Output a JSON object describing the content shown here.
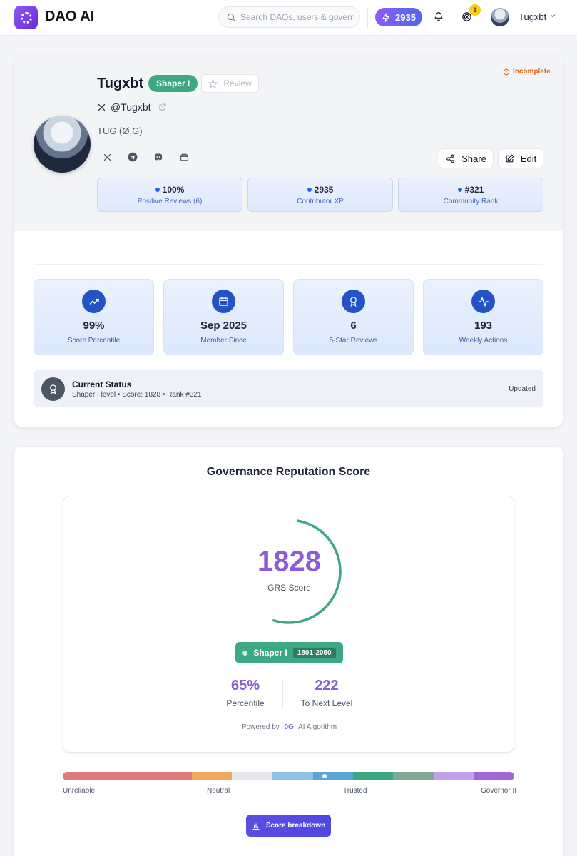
{
  "app": {
    "name": "DAO AI"
  },
  "search": {
    "placeholder": "Search DAOs, users & governance"
  },
  "header": {
    "xp": "2935",
    "notification_count": "1",
    "username": "Tugxbt"
  },
  "profile": {
    "name": "Tugxbt",
    "level": "Shaper I",
    "review_label": "Review",
    "status_flag": "Incomplete",
    "handle": "@Tugxbt",
    "token": "TUG (Ø,G)",
    "share_label": "Share",
    "edit_label": "Edit",
    "mini_stats": [
      {
        "value": "100%",
        "label": "Positive Reviews (6)"
      },
      {
        "value": "2935",
        "label": "Contributor XP"
      },
      {
        "value": "#321",
        "label": "Community Rank"
      }
    ]
  },
  "stats": [
    {
      "value": "99%",
      "label": "Score Percentile",
      "icon": "trending-up-icon"
    },
    {
      "value": "Sep 2025",
      "label": "Member Since",
      "icon": "calendar-icon"
    },
    {
      "value": "6",
      "label": "5-Star Reviews",
      "icon": "award-icon"
    },
    {
      "value": "193",
      "label": "Weekly Actions",
      "icon": "activity-icon"
    }
  ],
  "current_status": {
    "title": "Current Status",
    "subtitle": "Shaper I level • Score: 1828 • Rank #321",
    "updated": "Updated"
  },
  "reputation": {
    "title": "Governance Reputation Score",
    "score": "1828",
    "score_label": "GRS Score",
    "gauge_fraction": 0.52,
    "level": "Shaper I",
    "level_range": "1801-2050",
    "percentile": "65%",
    "percentile_label": "Percentile",
    "to_next": "222",
    "to_next_label": "To Next Level",
    "powered_prefix": "Powered by",
    "powered_brand": "0G",
    "powered_suffix": "AI Algorithm",
    "spectrum_labels": [
      "Unreliable",
      "Neutral",
      "Trusted",
      "Governor II"
    ],
    "spectrum_colors": [
      "#e07a7a",
      "#f0a95e",
      "#e5e7eb",
      "#8ec3e6",
      "#5aa5d4",
      "#3ea883",
      "#7fa896",
      "#c4a0ec",
      "#a169d8"
    ],
    "breakdown_label": "Score breakdown"
  },
  "colors": {
    "accent": "#8b5cd6",
    "level_green": "#3ea883",
    "primary_blue": "#2453c8"
  }
}
